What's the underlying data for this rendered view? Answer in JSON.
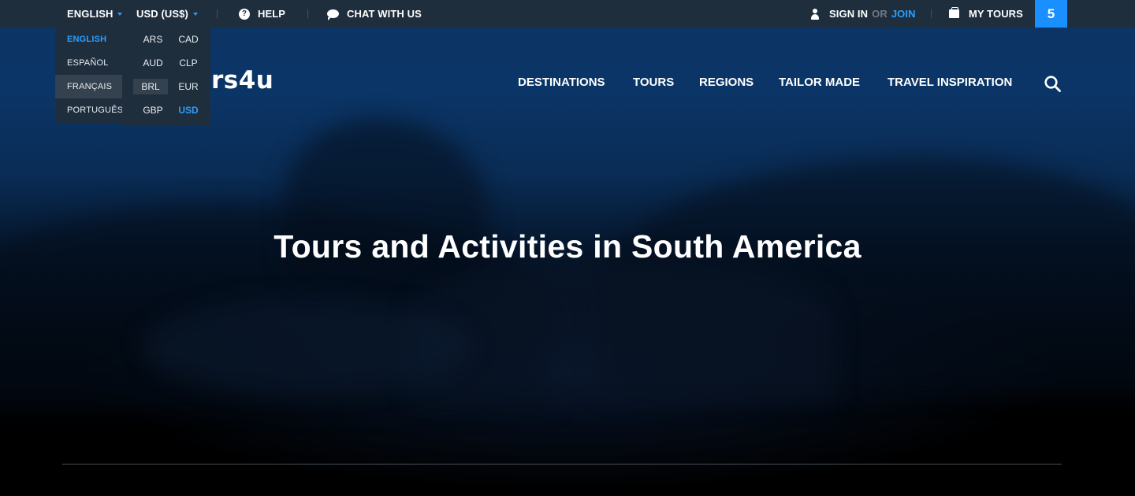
{
  "topbar": {
    "language": "ENGLISH",
    "currency": "USD (US$)",
    "help": "HELP",
    "chat": "CHAT WITH US",
    "sign_in": "SIGN IN",
    "or": "OR",
    "join": "JOIN",
    "my_tours": "MY TOURS",
    "my_tours_count": "5"
  },
  "language_menu": {
    "items": [
      "ENGLISH",
      "ESPAÑOL",
      "FRANÇAIS",
      "PORTUGUÊS"
    ],
    "selected": "ENGLISH",
    "hovered": "FRANÇAIS"
  },
  "currency_menu": {
    "items": [
      "ARS",
      "CAD",
      "AUD",
      "CLP",
      "BRL",
      "EUR",
      "GBP",
      "USD"
    ],
    "selected": "USD",
    "hovered": "BRL"
  },
  "logo": {
    "visible_text": "rs4u"
  },
  "nav": {
    "items": [
      "DESTINATIONS",
      "TOURS",
      "REGIONS",
      "TAILOR MADE",
      "TRAVEL INSPIRATION"
    ]
  },
  "hero": {
    "title": "Tours and Activities in South America"
  },
  "icons": {
    "help": "question-circle-icon",
    "chat": "chat-bubble-icon",
    "user": "user-icon",
    "bag": "briefcase-icon",
    "search": "search-icon",
    "caret": "caret-down-icon"
  },
  "colors": {
    "topbar_bg": "#1f2e3d",
    "accent": "#2a9fff",
    "badge_bg": "#1a8fff",
    "hero_top": "#0c3566"
  }
}
